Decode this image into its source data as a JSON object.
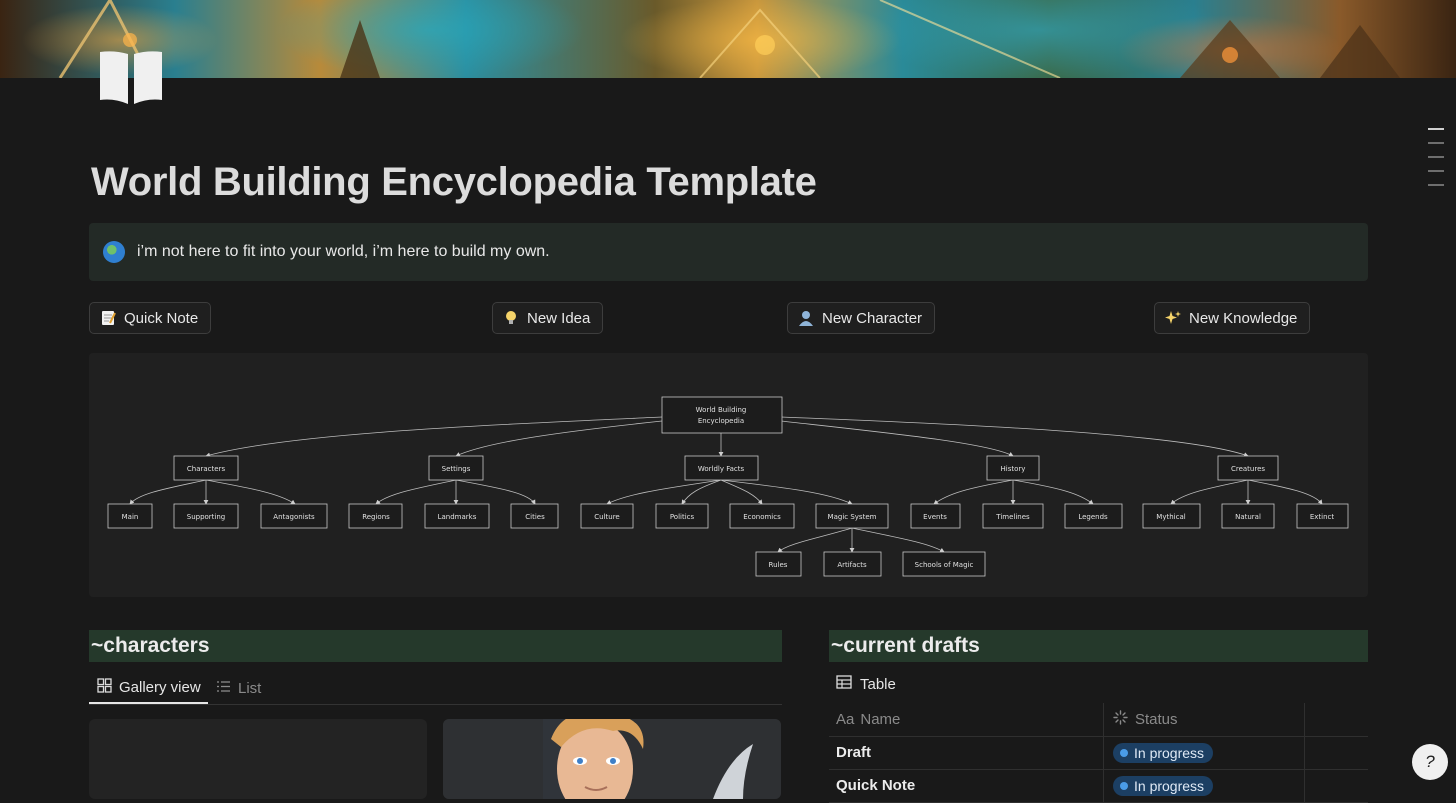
{
  "page": {
    "title": "World Building Encyclopedia Template",
    "callout": {
      "icon": "globe-emoji-icon",
      "text": "i’m not here to fit into your world, i’m here to build my own."
    }
  },
  "buttons": [
    {
      "icon": "memo-icon",
      "label": "Quick Note"
    },
    {
      "icon": "light-bulb-icon",
      "label": "New Idea"
    },
    {
      "icon": "person-icon",
      "label": "New Character"
    },
    {
      "icon": "sparkles-icon",
      "label": "New Knowledge"
    }
  ],
  "diagram": {
    "root": "World Building Encyclopedia",
    "categories": [
      {
        "label": "Characters",
        "children": [
          "Main",
          "Supporting",
          "Antagonists"
        ]
      },
      {
        "label": "Settings",
        "children": [
          "Regions",
          "Landmarks",
          "Cities"
        ]
      },
      {
        "label": "Worldly Facts",
        "children": [
          "Culture",
          "Politics",
          "Economics",
          "Magic System"
        ]
      },
      {
        "label": "History",
        "children": [
          "Events",
          "Timelines",
          "Legends"
        ]
      },
      {
        "label": "Creatures",
        "children": [
          "Mythical",
          "Natural",
          "Extinct"
        ]
      }
    ],
    "magic_system_children": [
      "Rules",
      "Artifacts",
      "Schools of Magic"
    ]
  },
  "characters": {
    "heading": "~characters",
    "tabs": [
      {
        "icon": "gallery-icon",
        "label": "Gallery view",
        "active": true
      },
      {
        "icon": "list-icon",
        "label": "List",
        "active": false
      }
    ]
  },
  "drafts": {
    "heading": "~current drafts",
    "view_label": "Table",
    "columns": [
      {
        "icon": "text-property-icon",
        "prefix": "Aa",
        "label": "Name"
      },
      {
        "icon": "status-property-icon",
        "label": "Status"
      }
    ],
    "rows": [
      {
        "name": "Draft",
        "status": "In progress"
      },
      {
        "name": "Quick Note",
        "status": "In progress"
      }
    ]
  },
  "colors": {
    "status_blue": "#1c3f63",
    "section_header": "#25392b",
    "callout_bg": "#232a26"
  }
}
